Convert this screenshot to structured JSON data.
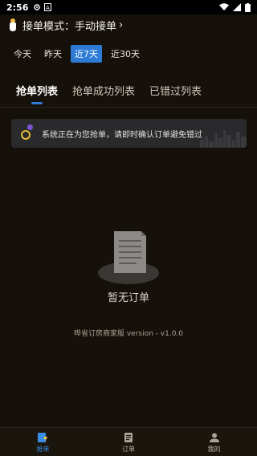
{
  "status_bar": {
    "time": "2:56"
  },
  "header": {
    "mode_label": "接单模式：",
    "mode_value": "手动接单",
    "chevron": "›"
  },
  "date_filter": {
    "options": [
      "今天",
      "昨天",
      "近7天",
      "近30天"
    ],
    "selected": "近7天"
  },
  "tabs": {
    "items": [
      "抢单列表",
      "抢单成功列表",
      "已错过列表"
    ],
    "active": "抢单列表"
  },
  "notice": {
    "text": "系统正在为您抢单，请即时确认订单避免错过"
  },
  "empty_state": {
    "text": "暂无订单"
  },
  "footer": {
    "version": "哗省订房商家版 version - v1.0.0"
  },
  "bottom_nav": {
    "items": [
      {
        "label": "抢单",
        "icon": "grab-order-icon"
      },
      {
        "label": "订单",
        "icon": "order-list-icon"
      },
      {
        "label": "我的",
        "icon": "profile-icon"
      }
    ],
    "active": "抢单"
  },
  "colors": {
    "background": "#151009",
    "accent": "#2e7bd6",
    "notice_ring": "#e5b93a"
  }
}
